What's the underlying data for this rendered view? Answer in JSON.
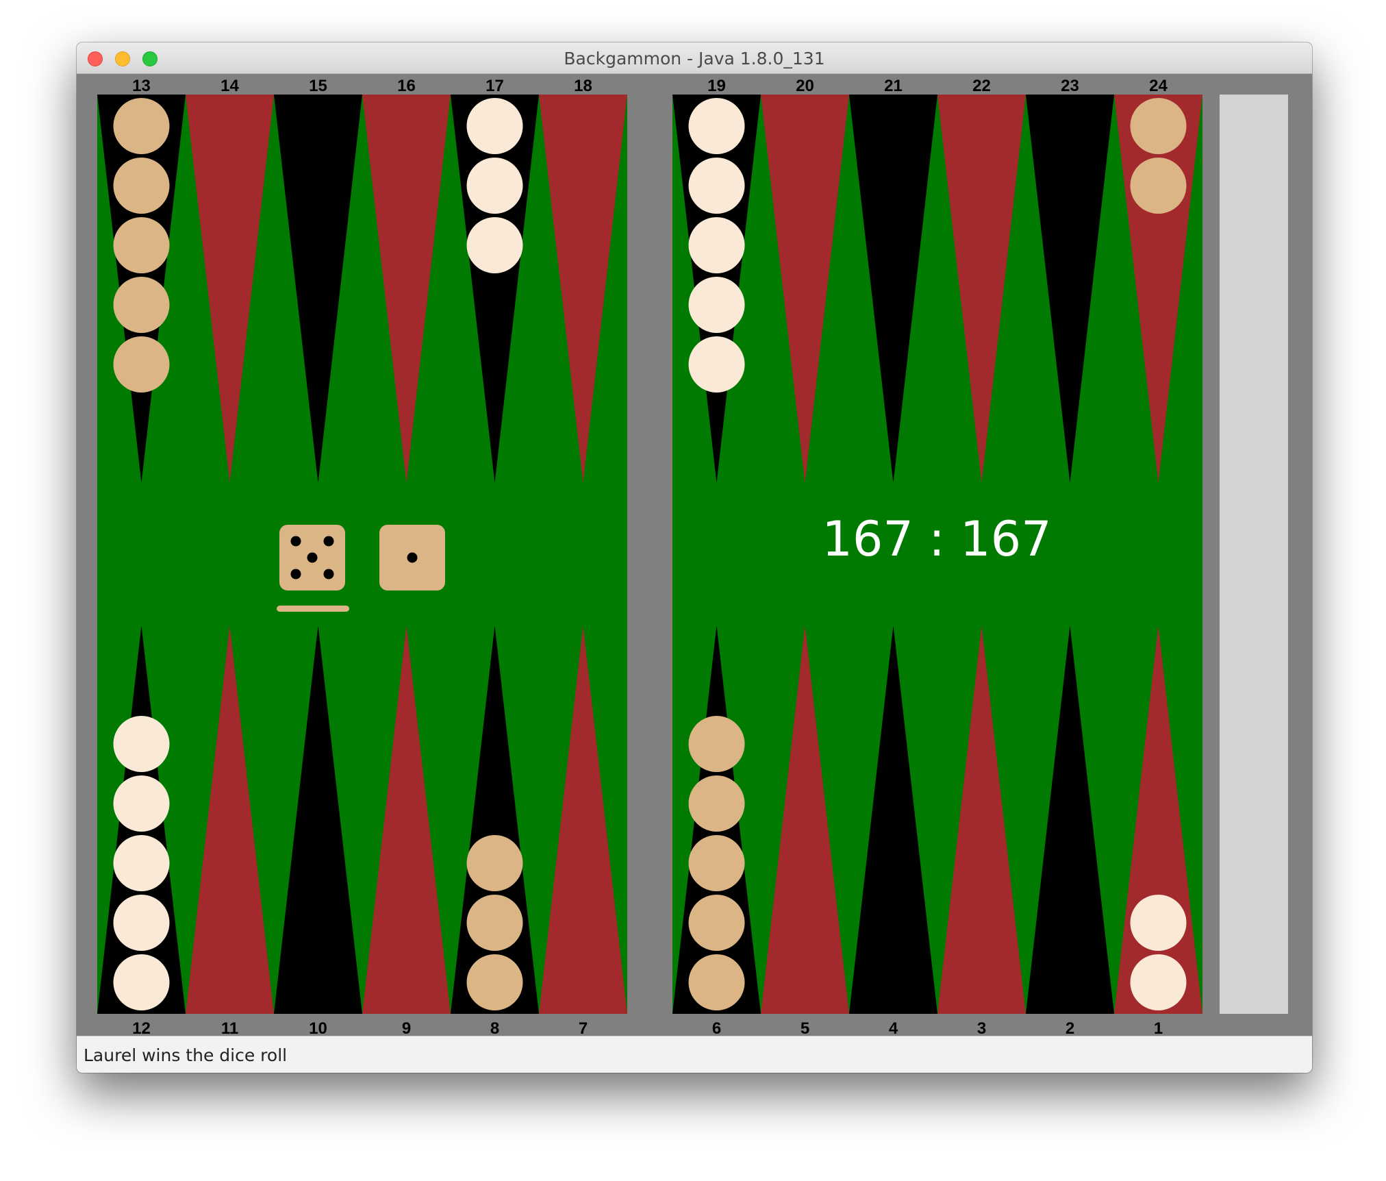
{
  "window": {
    "title": "Backgammon - Java 1.8.0_131",
    "status": "Laurel wins the dice roll"
  },
  "board": {
    "colors": {
      "felt": "#007a00",
      "frame": "#808080",
      "point_dark": "#000000",
      "point_red": "#a32a2c",
      "checker_tan": "#dbb585",
      "checker_cream": "#f9e9d6",
      "pip_count_text": "#ffffff",
      "bear_off_tray": "#d3d3d3"
    },
    "points": [
      {
        "number": "1",
        "checkers": 2,
        "color": "cream"
      },
      {
        "number": "2",
        "checkers": 0,
        "color": ""
      },
      {
        "number": "3",
        "checkers": 0,
        "color": ""
      },
      {
        "number": "4",
        "checkers": 0,
        "color": ""
      },
      {
        "number": "5",
        "checkers": 0,
        "color": ""
      },
      {
        "number": "6",
        "checkers": 5,
        "color": "tan"
      },
      {
        "number": "7",
        "checkers": 0,
        "color": ""
      },
      {
        "number": "8",
        "checkers": 3,
        "color": "tan"
      },
      {
        "number": "9",
        "checkers": 0,
        "color": ""
      },
      {
        "number": "10",
        "checkers": 0,
        "color": ""
      },
      {
        "number": "11",
        "checkers": 0,
        "color": ""
      },
      {
        "number": "12",
        "checkers": 5,
        "color": "cream"
      },
      {
        "number": "13",
        "checkers": 5,
        "color": "tan"
      },
      {
        "number": "14",
        "checkers": 0,
        "color": ""
      },
      {
        "number": "15",
        "checkers": 0,
        "color": ""
      },
      {
        "number": "16",
        "checkers": 0,
        "color": ""
      },
      {
        "number": "17",
        "checkers": 3,
        "color": "cream"
      },
      {
        "number": "18",
        "checkers": 0,
        "color": ""
      },
      {
        "number": "19",
        "checkers": 5,
        "color": "cream"
      },
      {
        "number": "20",
        "checkers": 0,
        "color": ""
      },
      {
        "number": "21",
        "checkers": 0,
        "color": ""
      },
      {
        "number": "22",
        "checkers": 0,
        "color": ""
      },
      {
        "number": "23",
        "checkers": 0,
        "color": ""
      },
      {
        "number": "24",
        "checkers": 2,
        "color": "tan"
      }
    ],
    "dice": [
      {
        "value": 5,
        "color": "tan",
        "selected": true
      },
      {
        "value": 1,
        "color": "tan",
        "selected": false
      }
    ],
    "pip_count": "167 : 167"
  }
}
